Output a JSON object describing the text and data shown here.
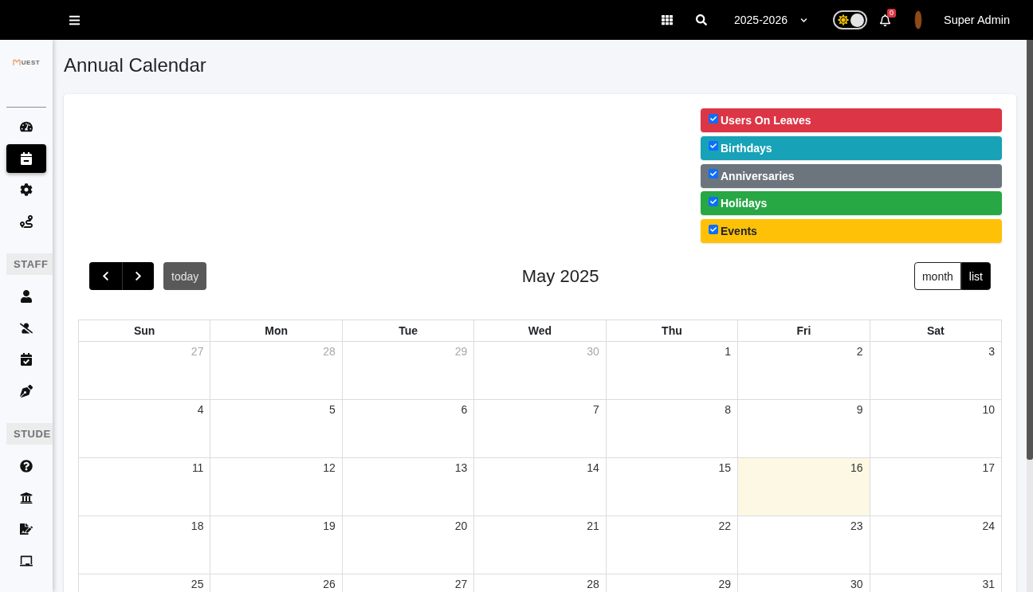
{
  "topbar": {
    "year": "2025-2026",
    "theme_switch": {
      "on": true
    },
    "notifications": "0",
    "user": "Super Admin"
  },
  "sidebar": {
    "logo": "UEST",
    "items": [
      {
        "kind": "link",
        "selected": false
      },
      {
        "kind": "link",
        "selected": true
      },
      {
        "kind": "link",
        "selected": false
      },
      {
        "kind": "link",
        "selected": false
      },
      {
        "kind": "section",
        "label": "STAFF"
      },
      {
        "kind": "link",
        "selected": false
      },
      {
        "kind": "link",
        "selected": false
      },
      {
        "kind": "link",
        "selected": false
      },
      {
        "kind": "link",
        "selected": false
      },
      {
        "kind": "section",
        "label": "STUDE"
      },
      {
        "kind": "link",
        "selected": false
      },
      {
        "kind": "link",
        "selected": false
      },
      {
        "kind": "link",
        "selected": false
      },
      {
        "kind": "link",
        "selected": false
      }
    ]
  },
  "page": {
    "title": "Annual Calendar"
  },
  "filters": [
    {
      "label": "Users On Leaves",
      "checked": true,
      "color": "#dc3545"
    },
    {
      "label": "Birthdays",
      "checked": true,
      "color": "#17a2b8"
    },
    {
      "label": "Anniversaries",
      "checked": true,
      "color": "#6c757d"
    },
    {
      "label": "Holidays",
      "checked": true,
      "color": "#28a745"
    },
    {
      "label": "Events",
      "checked": true,
      "color": "#ffc107"
    }
  ],
  "calendar": {
    "title": "May 2025",
    "today_button": {
      "label": "today",
      "disabled": true
    },
    "views": [
      {
        "label": "month",
        "selected": true
      },
      {
        "label": "list",
        "selected": false
      }
    ],
    "weekdays": [
      "Sun",
      "Mon",
      "Tue",
      "Wed",
      "Thu",
      "Fri",
      "Sat"
    ],
    "weeks": [
      [
        {
          "day": "27",
          "other_month": true,
          "today": false
        },
        {
          "day": "28",
          "other_month": true,
          "today": false
        },
        {
          "day": "29",
          "other_month": true,
          "today": false
        },
        {
          "day": "30",
          "other_month": true,
          "today": false
        },
        {
          "day": "1",
          "other_month": false,
          "today": false
        },
        {
          "day": "2",
          "other_month": false,
          "today": false
        },
        {
          "day": "3",
          "other_month": false,
          "today": false
        }
      ],
      [
        {
          "day": "4",
          "other_month": false,
          "today": false
        },
        {
          "day": "5",
          "other_month": false,
          "today": false
        },
        {
          "day": "6",
          "other_month": false,
          "today": false
        },
        {
          "day": "7",
          "other_month": false,
          "today": false
        },
        {
          "day": "8",
          "other_month": false,
          "today": false
        },
        {
          "day": "9",
          "other_month": false,
          "today": false
        },
        {
          "day": "10",
          "other_month": false,
          "today": false
        }
      ],
      [
        {
          "day": "11",
          "other_month": false,
          "today": false
        },
        {
          "day": "12",
          "other_month": false,
          "today": false
        },
        {
          "day": "13",
          "other_month": false,
          "today": false
        },
        {
          "day": "14",
          "other_month": false,
          "today": false
        },
        {
          "day": "15",
          "other_month": false,
          "today": false
        },
        {
          "day": "16",
          "other_month": false,
          "today": true
        },
        {
          "day": "17",
          "other_month": false,
          "today": false
        }
      ],
      [
        {
          "day": "18",
          "other_month": false,
          "today": false
        },
        {
          "day": "19",
          "other_month": false,
          "today": false
        },
        {
          "day": "20",
          "other_month": false,
          "today": false
        },
        {
          "day": "21",
          "other_month": false,
          "today": false
        },
        {
          "day": "22",
          "other_month": false,
          "today": false
        },
        {
          "day": "23",
          "other_month": false,
          "today": false
        },
        {
          "day": "24",
          "other_month": false,
          "today": false
        }
      ],
      [
        {
          "day": "25",
          "other_month": false,
          "today": false
        },
        {
          "day": "26",
          "other_month": false,
          "today": false
        },
        {
          "day": "27",
          "other_month": false,
          "today": false
        },
        {
          "day": "28",
          "other_month": false,
          "today": false
        },
        {
          "day": "29",
          "other_month": false,
          "today": false
        },
        {
          "day": "30",
          "other_month": false,
          "today": false
        },
        {
          "day": "31",
          "other_month": false,
          "today": false
        }
      ]
    ]
  }
}
